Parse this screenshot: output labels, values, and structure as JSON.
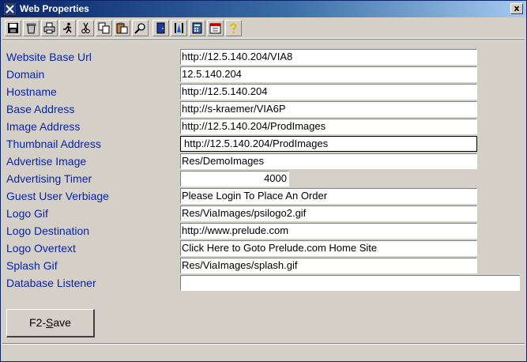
{
  "window": {
    "title": "Web Properties",
    "close_glyph": "x"
  },
  "toolbar": {
    "buttons": [
      {
        "icon": "save-icon"
      },
      {
        "icon": "clear-icon"
      },
      {
        "icon": "print-icon"
      },
      {
        "icon": "run-icon"
      },
      {
        "icon": "cut-icon"
      },
      {
        "icon": "copy-icon"
      },
      {
        "icon": "paste-icon"
      },
      {
        "icon": "find-icon"
      },
      {
        "icon": "exit-icon"
      },
      {
        "icon": "tools-icon"
      },
      {
        "icon": "calculator-icon"
      },
      {
        "icon": "calendar-icon"
      },
      {
        "icon": "help-icon"
      }
    ]
  },
  "form": {
    "fields": [
      {
        "label": "Website Base Url",
        "value": "http://12.5.140.204/VIA8"
      },
      {
        "label": "Domain",
        "value": "12.5.140.204"
      },
      {
        "label": "Hostname",
        "value": "http://12.5.140.204"
      },
      {
        "label": "Base Address",
        "value": "http://s-kraemer/VIA6P"
      },
      {
        "label": "Image Address",
        "value": "http://12.5.140.204/ProdImages"
      },
      {
        "label": "Thumbnail Address",
        "value": "http://12.5.140.204/ProdImages"
      },
      {
        "label": "Advertise Image",
        "value": "Res/DemoImages"
      },
      {
        "label": "Advertising Timer",
        "value": "4000"
      },
      {
        "label": "Guest User Verbiage",
        "value": "Please Login To Place An Order"
      },
      {
        "label": "Logo Gif",
        "value": "Res/ViaImages/psilogo2.gif"
      },
      {
        "label": "Logo Destination",
        "value": "http://www.prelude.com"
      },
      {
        "label": "Logo Overtext",
        "value": "Click Here to Goto Prelude.com Home Site"
      },
      {
        "label": "Splash Gif",
        "value": "Res/ViaImages/splash.gif"
      },
      {
        "label": "Database Listener",
        "value": ""
      }
    ]
  },
  "actions": {
    "save_prefix": "F2-",
    "save_key": "S",
    "save_rest": "ave"
  },
  "colors": {
    "label": "#0a24a6",
    "title_bar": "#0a246a",
    "face": "#d4d0c8"
  }
}
